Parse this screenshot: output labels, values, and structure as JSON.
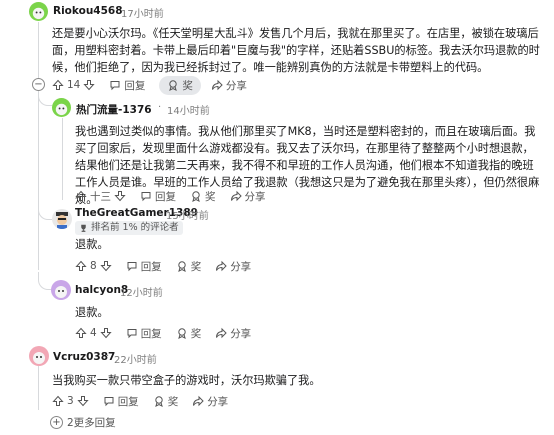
{
  "comments": [
    {
      "user": "Riokou4568",
      "time": "17小时前",
      "body": "还是要小心沃尔玛。《任天堂明星大乱斗》发售几个月后，我就在那里买了。在店里，被锁在玻璃后面，用塑料密封着。卡带上最后印着\"巨魔与我\"的字样，还贴着SSBU的标签。我去沃尔玛退款的时候，他们拒绝了，因为我已经拆封过了。唯一能辨别真伪的方法就是卡带塑料上的代码。",
      "votes": "14",
      "reply": "回复",
      "award": "奖",
      "share": "分享"
    },
    {
      "user": "热门流量-1376",
      "time": "14小时前",
      "body": "我也遇到过类似的事情。我从他们那里买了MK8，当时还是塑料密封的，而且在玻璃后面。我买了回家后，发现里面什么游戏都没有。我又去了沃尔玛，在那里待了整整两个小时想退款，结果他们还是让我第二天再来，我不得不和早班的工作人员沟通，他们根本不知道我指的晚班工作人员是谁。早班的工作人员给了我退款（我想这只是为了避免我在那里头疼），但仍然很麻烦。",
      "votes": "十三",
      "reply": "回复",
      "award": "奖",
      "share": "分享"
    },
    {
      "user": "TheGreatGamer1389",
      "time": "15小时前",
      "flair": "排名前 1% 的评论者",
      "body": "退款。",
      "votes": "8",
      "reply": "回复",
      "award": "奖",
      "share": "分享"
    },
    {
      "user": "halcyon8",
      "time": "12小时前",
      "body": "退款。",
      "votes": "4",
      "reply": "回复",
      "award": "奖",
      "share": "分享"
    },
    {
      "user": "Vcruz0387",
      "time": "22小时前",
      "body": "当我购买一款只带空盒子的游戏时，沃尔玛欺骗了我。",
      "votes": "3",
      "reply": "回复",
      "award": "奖",
      "share": "分享"
    }
  ],
  "more_replies": "2更多回复",
  "separator": "·",
  "icons": {
    "upvote": "arrow-up-icon",
    "downvote": "arrow-down-icon",
    "reply": "speech-bubble-icon",
    "award": "award-icon",
    "share": "share-arrow-icon",
    "collapse": "minus-circle-icon",
    "expand": "plus-circle-icon"
  },
  "colors": {
    "avatar_green": "#7bd44a",
    "avatar_purple": "#c9a6e8",
    "avatar_pink": "#f2a7b5",
    "thread_line": "#d7d9dc"
  }
}
